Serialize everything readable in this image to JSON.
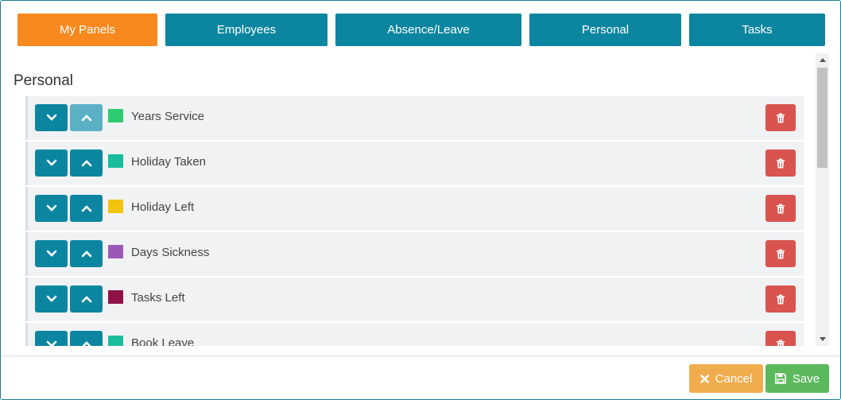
{
  "tabs": [
    {
      "label": "My Panels",
      "active": true
    },
    {
      "label": "Employees",
      "active": false
    },
    {
      "label": "Absence/Leave",
      "active": false
    },
    {
      "label": "Personal",
      "active": false
    },
    {
      "label": "Tasks",
      "active": false
    }
  ],
  "section": {
    "title": "Personal"
  },
  "panels": [
    {
      "label": "Years Service",
      "color": "#2ecc71",
      "up_disabled": true
    },
    {
      "label": "Holiday Taken",
      "color": "#1abc9c",
      "up_disabled": false
    },
    {
      "label": "Holiday Left",
      "color": "#f1c40f",
      "up_disabled": false
    },
    {
      "label": "Days Sickness",
      "color": "#9b59b6",
      "up_disabled": false
    },
    {
      "label": "Tasks Left",
      "color": "#8e1245",
      "up_disabled": false
    },
    {
      "label": "Book Leave",
      "color": "#1abc9c",
      "up_disabled": false
    }
  ],
  "footer": {
    "cancel_label": "Cancel",
    "save_label": "Save"
  },
  "colors": {
    "primary": "#0c86a0",
    "active_tab": "#f7891f",
    "danger": "#d9534f",
    "warning": "#f0ad4e",
    "success": "#5cb85c"
  },
  "icons": {
    "move_down": "chevron-down-icon",
    "move_up": "chevron-up-icon",
    "delete": "trash-icon",
    "cancel": "close-icon",
    "save": "floppy-disk-icon"
  }
}
